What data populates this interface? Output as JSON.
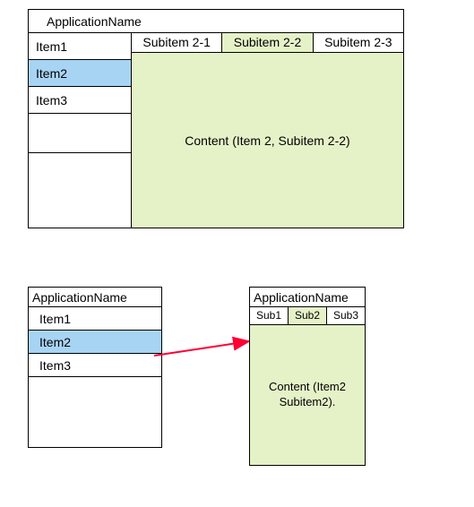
{
  "large": {
    "title": "ApplicationName",
    "sidebar": {
      "items": [
        {
          "label": "Item1",
          "selected": false
        },
        {
          "label": "Item2",
          "selected": true
        },
        {
          "label": "Item3",
          "selected": false
        }
      ]
    },
    "tabs": [
      {
        "label": "Subitem 2-1",
        "active": false
      },
      {
        "label": "Subitem 2-2",
        "active": true
      },
      {
        "label": "Subitem 2-3",
        "active": false
      }
    ],
    "content": "Content (Item 2, Subitem 2-2)"
  },
  "smallLeft": {
    "title": "ApplicationName",
    "sidebar": {
      "items": [
        {
          "label": "Item1",
          "selected": false
        },
        {
          "label": "Item2",
          "selected": true
        },
        {
          "label": "Item3",
          "selected": false
        }
      ]
    }
  },
  "smallRight": {
    "title": "ApplicationName",
    "tabs": [
      {
        "label": "Sub1",
        "active": false
      },
      {
        "label": "Sub2",
        "active": true
      },
      {
        "label": "Sub3",
        "active": false
      }
    ],
    "content": "Content (Item2 Subitem2)."
  },
  "colors": {
    "selected_bg": "#a8d4f4",
    "content_bg": "#e5f2c8",
    "arrow": "#ff0033"
  }
}
